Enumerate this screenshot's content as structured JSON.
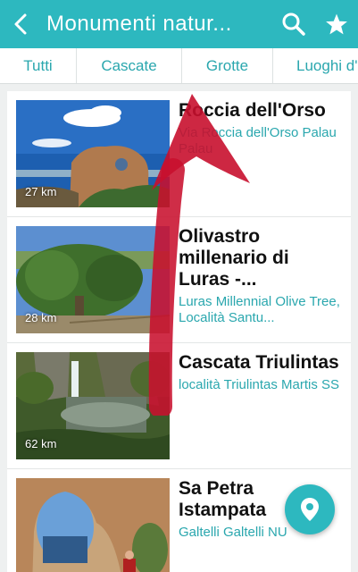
{
  "appbar": {
    "title": "Monumenti  natur...",
    "back_icon": "arrow-left-icon",
    "search_icon": "search-icon",
    "favorite_icon": "star-icon"
  },
  "tabs": [
    {
      "label": "Tutti"
    },
    {
      "label": "Cascate"
    },
    {
      "label": "Grotte"
    },
    {
      "label": "Luoghi d'"
    }
  ],
  "items": [
    {
      "name": "Roccia dell'Orso",
      "subtitle": "Via Roccia dell'Orso Palau Palau",
      "distance": "27 km"
    },
    {
      "name": "Olivastro millenario di Luras -...",
      "subtitle": "Luras Millennial Olive Tree, Località Santu...",
      "distance": "28 km"
    },
    {
      "name": "Cascata Triulintas",
      "subtitle": "località Triulintas Martis SS",
      "distance": "62 km"
    },
    {
      "name": "Sa Petra Istampata",
      "subtitle": "Galtelli Galtelli NU",
      "distance": ""
    }
  ],
  "fab": {
    "icon": "map-pin-icon"
  },
  "colors": {
    "primary": "#2db8bf",
    "accent_text": "#2aa7ae",
    "overlay_arrow": "#c8102e"
  }
}
